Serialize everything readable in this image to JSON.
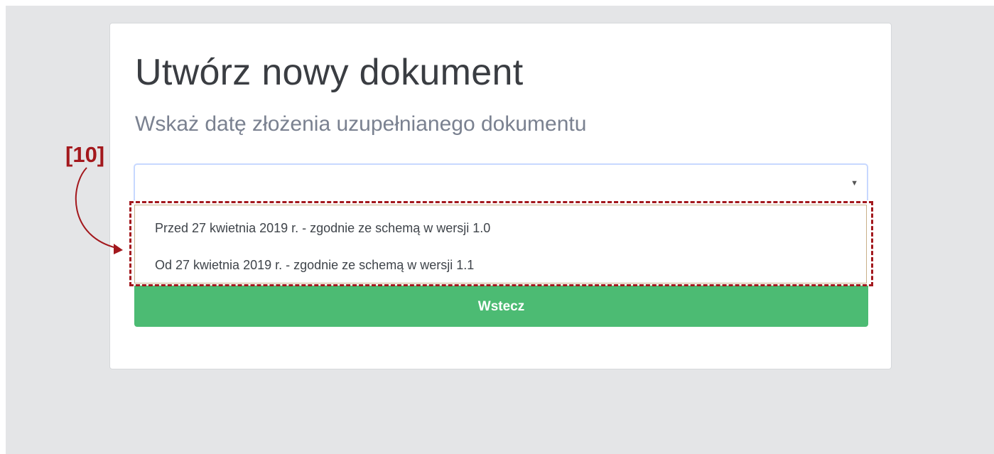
{
  "page": {
    "title": "Utwórz nowy dokument",
    "subtitle": "Wskaż datę złożenia uzupełnianego dokumentu"
  },
  "select": {
    "value": "",
    "icon": "caret-down-icon",
    "caret_glyph": "▼",
    "options": [
      "Przed 27 kwietnia 2019 r. - zgodnie ze schemą w wersji 1.0",
      "Od 27 kwietnia 2019 r. - zgodnie ze schemą w wersji 1.1"
    ]
  },
  "back_button": {
    "label": "Wstecz"
  },
  "annotation": {
    "label": "[10]",
    "color": "#a3181d"
  },
  "colors": {
    "button_green": "#4cbb73",
    "page_background": "#e4e5e7",
    "annotation_red": "#a3181d"
  }
}
